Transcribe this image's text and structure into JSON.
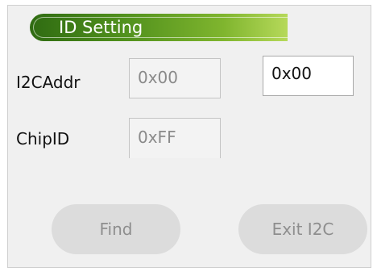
{
  "panel": {
    "title": "ID Setting"
  },
  "fields": {
    "i2caddr_label": "I2CAddr",
    "i2caddr_value": "0x00",
    "i2caddr_input_value": "0x00",
    "chipid_label": "ChipID",
    "chipid_value": "0xFF"
  },
  "buttons": {
    "find_label": "Find",
    "exit_label": "Exit I2C"
  },
  "colors": {
    "title_gradient_start": "#2f6b12",
    "title_gradient_end": "#b6d95a",
    "button_bg": "#dcdcdc",
    "button_text": "#8e8e8e"
  },
  "state": {
    "buttons_disabled": true
  }
}
